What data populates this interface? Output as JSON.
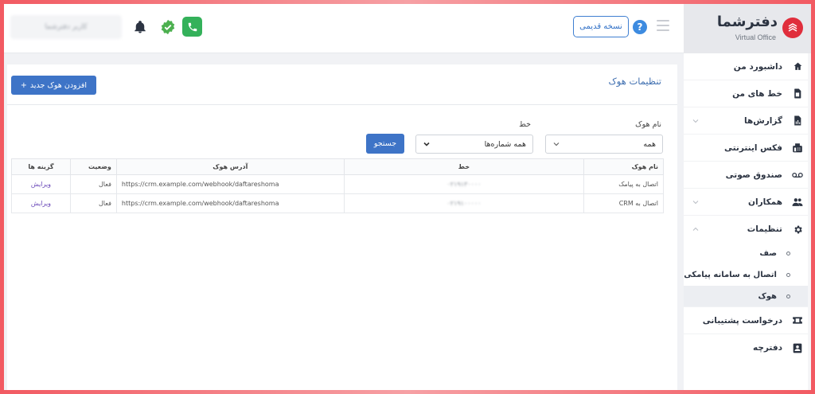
{
  "header": {
    "user_name": "کاربر دفترشما",
    "old_version_label": "نسخه قدیمی",
    "help_symbol": "?"
  },
  "sidebar": {
    "logo_title": "دفترشما",
    "logo_subtitle": "Virtual Office",
    "items": [
      {
        "label": "داشبورد من",
        "icon": "home-icon"
      },
      {
        "label": "خط های من",
        "icon": "sim-card-icon"
      },
      {
        "label": "گزارش‌ها",
        "icon": "report-icon",
        "expandable": true
      },
      {
        "label": "فکس اینترنتی",
        "icon": "fax-icon"
      },
      {
        "label": "صندوق صوتی",
        "icon": "voicemail-icon"
      },
      {
        "label": "همکاران",
        "icon": "users-icon",
        "expandable": true
      },
      {
        "label": "تنظیمات",
        "icon": "gear-icon",
        "expanded": true
      }
    ],
    "settings_sub": [
      {
        "label": "صف"
      },
      {
        "label": "اتصال به سامانه پیامکی"
      },
      {
        "label": "هوک",
        "active": true
      }
    ],
    "items_after": [
      {
        "label": "درخواست پشتیبانی",
        "icon": "ticket-icon"
      },
      {
        "label": "دفترچه",
        "icon": "contacts-icon"
      }
    ]
  },
  "main": {
    "title": "تنظیمات هوک",
    "add_button": "افزودن هوک جدید",
    "add_symbol": "+",
    "filters": {
      "name_label": "نام هوک",
      "name_value": "همه",
      "line_label": "خط",
      "line_value": "همه شماره‌ها",
      "search_button": "جستجو"
    },
    "table": {
      "headers": [
        "نام هوک",
        "خط",
        "آدرس هوک",
        "وضعیت",
        "گزینه ها"
      ],
      "rows": [
        {
          "name": "اتصال به پیامک",
          "line": "۰۲۱۹۱۳۰۰۰۰",
          "url": "https://crm.example.com/webhook/daftareshoma",
          "status": "فعال",
          "action": "ویرایش"
        },
        {
          "name": "اتصال به CRM",
          "line": "۰۲۱۹۱۰۰۰۰۰",
          "url": "https://crm.example.com/webhook/daftareshoma",
          "status": "فعال",
          "action": "ویرایش"
        }
      ]
    }
  },
  "colors": {
    "accent": "#3e74c7",
    "phone_green": "#34b15a",
    "brand_red": "#e02e3c",
    "edit_link": "#6a48b8"
  }
}
